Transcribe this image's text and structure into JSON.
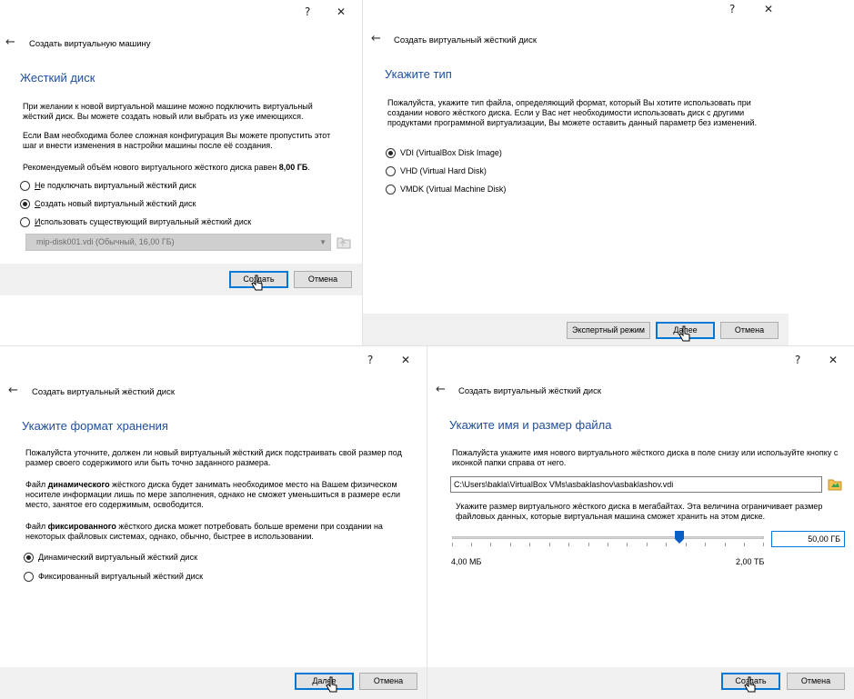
{
  "common": {
    "help": "?",
    "close": "✕",
    "back": "←",
    "cancel": "Отмена"
  },
  "dlg1": {
    "title": "Создать виртуальную машину",
    "heading": "Жесткий диск",
    "p1": "При желании к новой виртуальной машине можно подключить виртуальный жёсткий диск. Вы можете создать новый или выбрать из уже имеющихся.",
    "p2": "Если Вам необходима более сложная конфигурация Вы можете пропустить этот шаг и внести изменения в настройки машины после её создания.",
    "p3_prefix": "Рекомендуемый объём нового виртуального жёсткого диска равен ",
    "p3_bold": "8,00 ГБ",
    "p3_suffix": ".",
    "opt1_u": "Н",
    "opt1_rest": "е подключать виртуальный жёсткий диск",
    "opt2_u": "С",
    "opt2_rest": "оздать новый виртуальный жёсткий диск",
    "opt3_u": "И",
    "opt3_rest": "спользовать существующий виртуальный жёсткий диск",
    "combo_value": "mip-disk001.vdi (Обычный, 16,00 ГБ)",
    "create_btn": "Создать"
  },
  "dlg2": {
    "title": "Создать виртуальный жёсткий диск",
    "heading": "Укажите тип",
    "p1": "Пожалуйста, укажите тип файла, определяющий формат, который Вы хотите использовать при создании нового жёсткого диска. Если у Вас нет необходимости использовать диск с другими продуктами программной виртуализации, Вы можете оставить данный параметр без изменений.",
    "opt_vdi": "VDI (VirtualBox Disk Image)",
    "opt_vhd": "VHD (Virtual Hard Disk)",
    "opt_vmdk": "VMDK (Virtual Machine Disk)",
    "expert_btn": "Экспертный режим",
    "next_btn": "Далее"
  },
  "dlg3": {
    "title": "Создать виртуальный жёсткий диск",
    "heading": "Укажите формат хранения",
    "p1": "Пожалуйста уточните, должен ли новый виртуальный жёсткий диск подстраивать свой размер под размер своего содержимого или быть точно заданного размера.",
    "p2_prefix": "Файл ",
    "p2_bold": "динамического",
    "p2_suffix": " жёсткого диска будет занимать необходимое место на Вашем физическом носителе информации лишь по мере заполнения, однако не сможет уменьшиться в размере если место, занятое его содержимым, освободится.",
    "p3_prefix": "Файл ",
    "p3_bold": "фиксированного",
    "p3_suffix": " жёсткого диска может потребовать больше времени при создании на некоторых файловых системах, однако, обычно, быстрее в использовании.",
    "opt_dynamic": "Динамический виртуальный жёсткий диск",
    "opt_fixed": "Фиксированный виртуальный жёсткий диск",
    "next_btn": "Далее"
  },
  "dlg4": {
    "title": "Создать виртуальный жёсткий диск",
    "heading": "Укажите имя и размер файла",
    "p1": "Пожалуйста укажите имя нового виртуального жёсткого диска в поле снизу или используйте кнопку с иконкой папки справа от него.",
    "path_value": "C:\\Users\\bakla\\VirtualBox VMs\\asbaklashov\\asbaklashov.vdi",
    "p2": "Укажите размер виртуального жёсткого диска в мегабайтах. Эта величина ограничивает размер файловых данных, которые виртуальная машина сможет хранить на этом диске.",
    "size_value": "50,00 ГБ",
    "size_fraction": 0.73,
    "min_label": "4,00 МБ",
    "max_label": "2,00 ТБ",
    "create_btn": "Создать"
  }
}
